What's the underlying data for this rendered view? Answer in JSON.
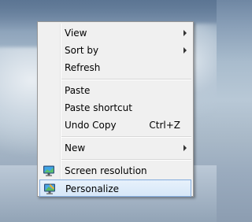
{
  "menu": {
    "items": [
      {
        "label": "View",
        "has_submenu": true
      },
      {
        "label": "Sort by",
        "has_submenu": true
      },
      {
        "label": "Refresh"
      },
      {
        "label": "Paste"
      },
      {
        "label": "Paste shortcut"
      },
      {
        "label": "Undo Copy",
        "shortcut": "Ctrl+Z"
      },
      {
        "label": "New",
        "has_submenu": true
      },
      {
        "label": "Screen resolution",
        "icon": "display-settings-icon"
      },
      {
        "label": "Personalize",
        "icon": "personalize-icon",
        "highlighted": true
      }
    ]
  },
  "colors": {
    "menu_background": "#f0f0f0",
    "highlight_fill": "#d6e7f8",
    "highlight_border": "#84acdd"
  }
}
